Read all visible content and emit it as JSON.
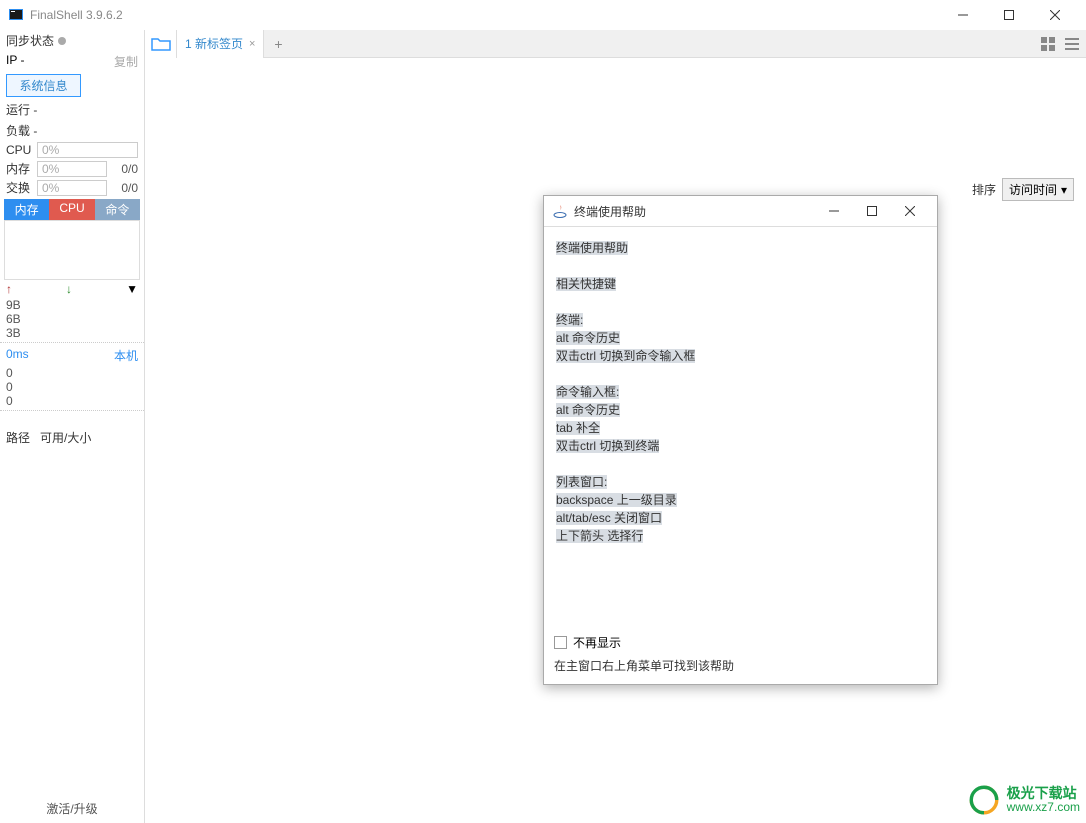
{
  "window": {
    "title": "FinalShell 3.9.6.2"
  },
  "sidebar": {
    "sync": "同步状态",
    "ip_label": "IP  -",
    "copy": "复制",
    "sys_info": "系统信息",
    "run": "运行 -",
    "load": "负载 -",
    "cpu_label": "CPU",
    "cpu_val": "0%",
    "mem_label": "内存",
    "mem_val": "0%",
    "mem_num": "0/0",
    "swap_label": "交换",
    "swap_val": "0%",
    "swap_num": "0/0",
    "tab_mem": "内存",
    "tab_cpu": "CPU",
    "tab_cmd": "命令",
    "up": "↑",
    "down": "↓",
    "tri": "▼",
    "net_9b": "9B",
    "net_6b": "6B",
    "net_3b": "3B",
    "ms": "0ms",
    "local": "本机",
    "z0": "0",
    "path": "路径",
    "size": "可用/大小",
    "activate": "激活/升级"
  },
  "tabs": {
    "tab1": "1 新标签页",
    "close": "×",
    "add": "+"
  },
  "sort": {
    "label": "排序",
    "value": "访问时间"
  },
  "dialog": {
    "title": "终端使用帮助",
    "l1": "终端使用帮助",
    "l2": "相关快捷键",
    "l3": "终端:",
    "l4": "alt 命令历史",
    "l5": "双击ctrl 切换到命令输入框",
    "l6": "命令输入框:",
    "l7": "alt 命令历史",
    "l8": "tab 补全",
    "l9": "双击ctrl 切换到终端",
    "l10": "列表窗口:",
    "l11": "backspace 上一级目录",
    "l12": "alt/tab/esc 关闭窗口",
    "l13": "上下箭头 选择行",
    "chk": "不再显示",
    "note": "在主窗口右上角菜单可找到该帮助"
  },
  "watermark": {
    "cn": "极光下载站",
    "url": "www.xz7.com"
  }
}
